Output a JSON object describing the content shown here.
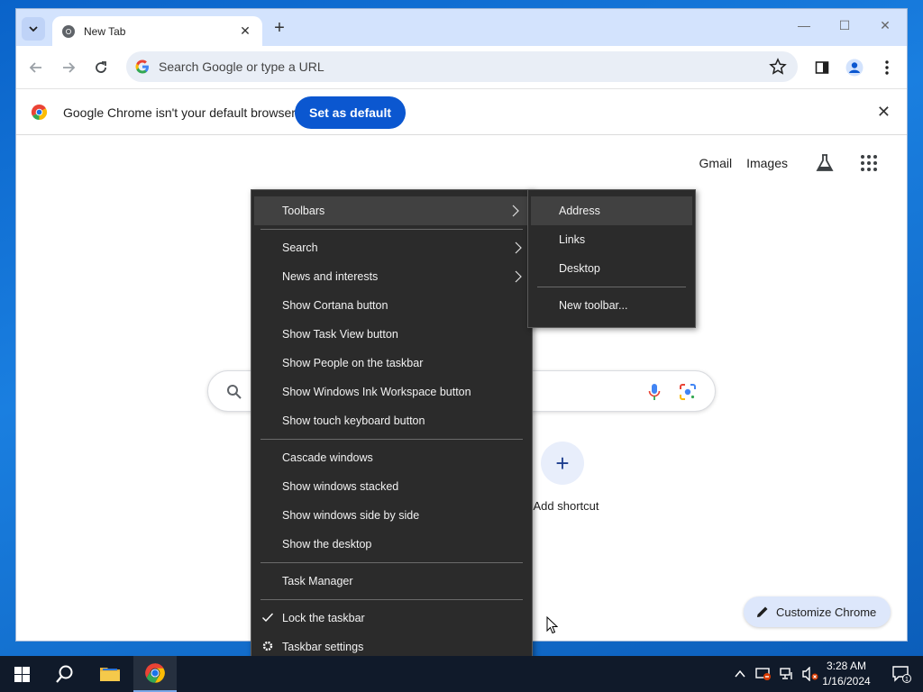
{
  "tab": {
    "title": "New Tab"
  },
  "omnibox": {
    "placeholder": "Search Google or type a URL"
  },
  "infobar": {
    "message": "Google Chrome isn't your default browser",
    "button": "Set as default"
  },
  "ntp": {
    "links": [
      "Gmail",
      "Images"
    ],
    "shortcut_label": "Add shortcut",
    "customize_label": "Customize Chrome"
  },
  "context_menu": {
    "items": [
      {
        "label": "Toolbars"
      },
      {
        "label": "Search"
      },
      {
        "label": "News and interests"
      },
      {
        "label": "Show Cortana button"
      },
      {
        "label": "Show Task View button"
      },
      {
        "label": "Show People on the taskbar"
      },
      {
        "label": "Show Windows Ink Workspace button"
      },
      {
        "label": "Show touch keyboard button"
      },
      {
        "label": "Cascade windows"
      },
      {
        "label": "Show windows stacked"
      },
      {
        "label": "Show windows side by side"
      },
      {
        "label": "Show the desktop"
      },
      {
        "label": "Task Manager"
      },
      {
        "label": "Lock the taskbar"
      },
      {
        "label": "Taskbar settings"
      }
    ]
  },
  "submenu": {
    "items": [
      {
        "label": "Address"
      },
      {
        "label": "Links"
      },
      {
        "label": "Desktop"
      },
      {
        "label": "New toolbar..."
      }
    ]
  },
  "taskbar": {
    "time": "3:28 AM",
    "date": "1/16/2024",
    "notification_count": "1"
  },
  "colors": {
    "accent": "#0b57d0",
    "menu_bg": "#2b2b2b",
    "taskbar_bg": "#101a2a",
    "tabstrip_bg": "#d3e3fd"
  }
}
